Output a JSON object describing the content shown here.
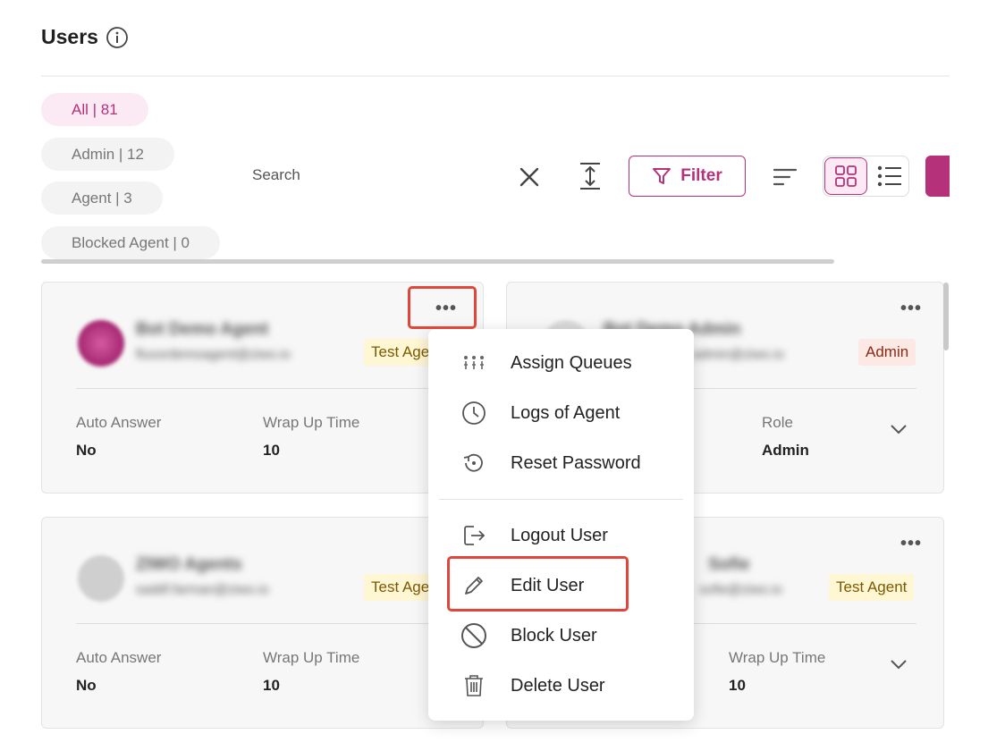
{
  "page": {
    "title": "Users"
  },
  "tabs": [
    {
      "label": "All | 81",
      "active": true
    },
    {
      "label": "Admin | 12",
      "active": false
    },
    {
      "label": "Agent | 3",
      "active": false
    },
    {
      "label": "Blocked Agent | 0",
      "active": false
    }
  ],
  "toolbar": {
    "search_label": "Search",
    "filter_label": "Filter",
    "icons": [
      "close-icon",
      "expand-vertical-icon",
      "filter-funnel-icon",
      "sort-icon",
      "grid-view-icon",
      "list-view-icon"
    ]
  },
  "cards": [
    {
      "name": "Bot Demo Agent",
      "email": "fluxordemoagent@ziwo.io",
      "role_badge": "Test Agent",
      "fields": [
        {
          "label": "Auto Answer",
          "value": "No"
        },
        {
          "label": "Wrap Up Time",
          "value": "10"
        }
      ]
    },
    {
      "name": "Bot Demo Admin",
      "email": "admin@ziwo.io",
      "role_badge": "Admin",
      "fields": [
        {
          "label": "Role",
          "value": "Admin"
        }
      ]
    },
    {
      "name": "ZIWO Agents",
      "email": "saddf.farman@ziwo.io",
      "role_badge": "Test Agent",
      "fields": [
        {
          "label": "Auto Answer",
          "value": "No"
        },
        {
          "label": "Wrap Up Time",
          "value": "10"
        }
      ]
    },
    {
      "name": "Sofie",
      "email": "sofie@ziwo.io",
      "role_badge": "Test Agent",
      "fields": [
        {
          "label": "Wrap Up Time",
          "value": "10"
        }
      ]
    }
  ],
  "context_menu": {
    "items": [
      {
        "label": "Assign Queues",
        "icon": "assign-queues-icon"
      },
      {
        "label": "Logs of Agent",
        "icon": "clock-icon"
      },
      {
        "label": "Reset Password",
        "icon": "reset-icon"
      },
      {
        "label": "Logout User",
        "icon": "logout-icon"
      },
      {
        "label": "Edit User",
        "icon": "pencil-icon"
      },
      {
        "label": "Block User",
        "icon": "block-icon"
      },
      {
        "label": "Delete User",
        "icon": "trash-icon"
      }
    ]
  },
  "colors": {
    "accent": "#b5317a",
    "accent_light": "#fbeaf3",
    "highlight": "#e2453a",
    "badge_agent_bg": "#fff6d4",
    "badge_admin_bg": "#fde9e4"
  }
}
